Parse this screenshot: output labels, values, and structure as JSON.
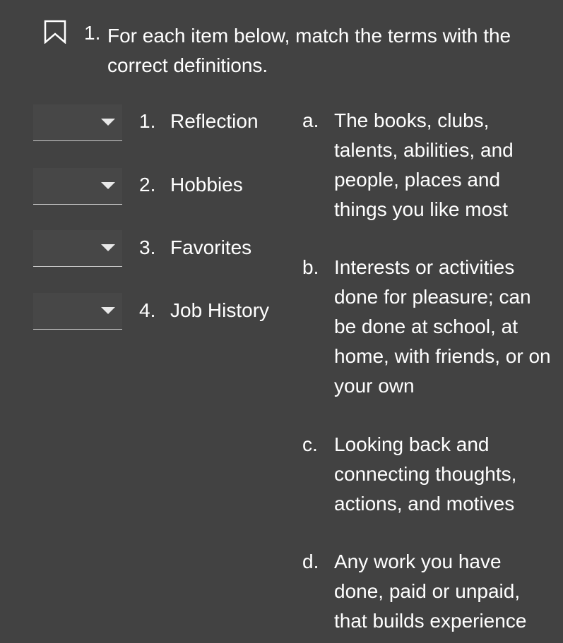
{
  "question": {
    "number": "1.",
    "text": "For each item below, match the terms with the correct definitions."
  },
  "icons": {
    "bookmark": "bookmark-outline-icon",
    "dropdown_arrow": "caret-down-icon"
  },
  "terms": [
    {
      "number": "1.",
      "label": "Reflection",
      "selected": ""
    },
    {
      "number": "2.",
      "label": "Hobbies",
      "selected": ""
    },
    {
      "number": "3.",
      "label": "Favorites",
      "selected": ""
    },
    {
      "number": "4.",
      "label": "Job History",
      "selected": ""
    }
  ],
  "definitions": [
    {
      "letter": "a.",
      "text": "The books, clubs, talents, abilities, and people, places and things you like most"
    },
    {
      "letter": "b.",
      "text": "Interests or activities done for pleasure; can be done at school, at home, with friends, or on your own"
    },
    {
      "letter": "c.",
      "text": "Looking back and connecting thoughts, actions, and motives"
    },
    {
      "letter": "d.",
      "text": "Any work you have done, paid or unpaid, that builds experience"
    }
  ],
  "colors": {
    "background": "#424242",
    "text": "#ffffff",
    "dropdown_underline": "#cfcfcf"
  }
}
